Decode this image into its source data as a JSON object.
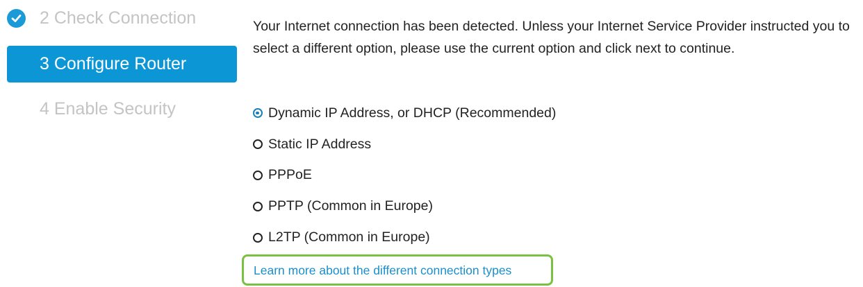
{
  "sidebar": {
    "steps": [
      {
        "label": "2 Check Connection",
        "state": "completed"
      },
      {
        "label": "3 Configure Router",
        "state": "active"
      },
      {
        "label": "4 Enable Security",
        "state": "upcoming"
      }
    ]
  },
  "main": {
    "intro_text": "Your Internet connection has been detected. Unless your Internet Service Provider instructed you to select a different option, please use the current option and click next to continue.",
    "connection_types": [
      {
        "label": "Dynamic IP Address, or DHCP (Recommended)",
        "selected": true
      },
      {
        "label": "Static IP Address",
        "selected": false
      },
      {
        "label": "PPPoE",
        "selected": false
      },
      {
        "label": "PPTP (Common in Europe)",
        "selected": false
      },
      {
        "label": "L2TP (Common in Europe)",
        "selected": false
      }
    ],
    "learn_more_link": "Learn more about the different connection types"
  },
  "colors": {
    "accent": "#0d96d6",
    "highlight_border": "#7ac143",
    "inactive_text": "#c4c4c4",
    "link": "#1a8fc9"
  },
  "icons": {
    "completed_step": "check-circle-icon"
  }
}
